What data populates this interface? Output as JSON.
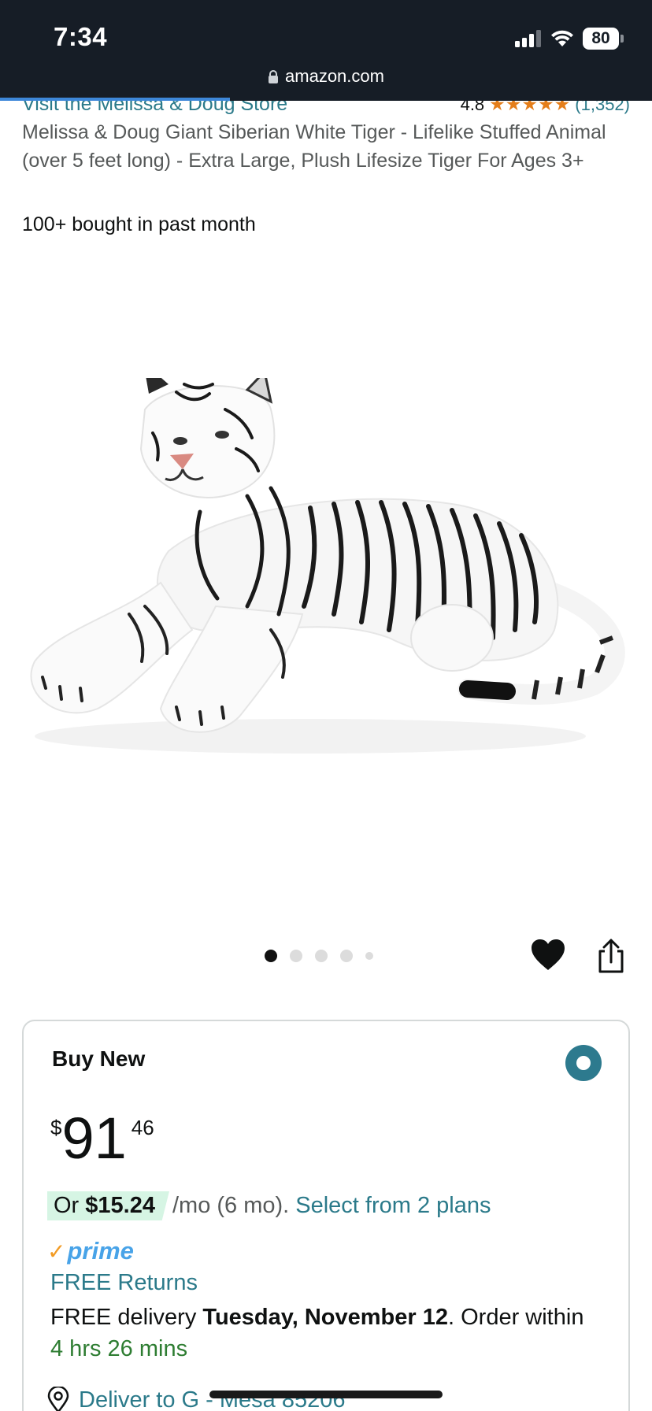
{
  "status_bar": {
    "time": "7:34",
    "battery": "80",
    "icons": [
      "signal-icon",
      "wifi-icon",
      "battery-icon"
    ]
  },
  "browser": {
    "url": "amazon.com",
    "lock_icon": "lock-icon",
    "load_progress": 0.35
  },
  "product": {
    "store_link": "Visit the Melissa & Doug Store",
    "rating": "4.8",
    "stars": 4.8,
    "review_count": "(1,352)",
    "title": "Melissa & Doug Giant Siberian White Tiger - Lifelike Stuffed Animal (over 5 feet long) - Extra Large, Plush Lifesize Tiger For Ages 3+",
    "bought": "100+ bought in past month",
    "image_icon": "white-tiger-plush-image",
    "carousel": {
      "count": 5,
      "active": 0
    }
  },
  "buy_box": {
    "heading": "Buy New",
    "price_symbol": "$",
    "price_whole": "91",
    "price_fraction": "46",
    "monthly_prefix": "Or ",
    "monthly_amount": "$15.24",
    "monthly_suffix": " /mo (6 mo).",
    "plans_link": "Select from 2 plans",
    "prime_label": "prime",
    "free_returns": "FREE Returns",
    "delivery_prefix": "FREE delivery ",
    "delivery_date": "Tuesday, November 12",
    "delivery_suffix": ". Order within",
    "countdown": "4 hrs 26 mins",
    "deliver_to": "Deliver to G - Mesa 85206"
  },
  "colors": {
    "topbar": "#161d26",
    "link": "#2b7a8a",
    "star": "#e57e1a",
    "prime": "#48a3e8",
    "countdown": "#2e7d32",
    "highlight": "#d6f5e4"
  }
}
